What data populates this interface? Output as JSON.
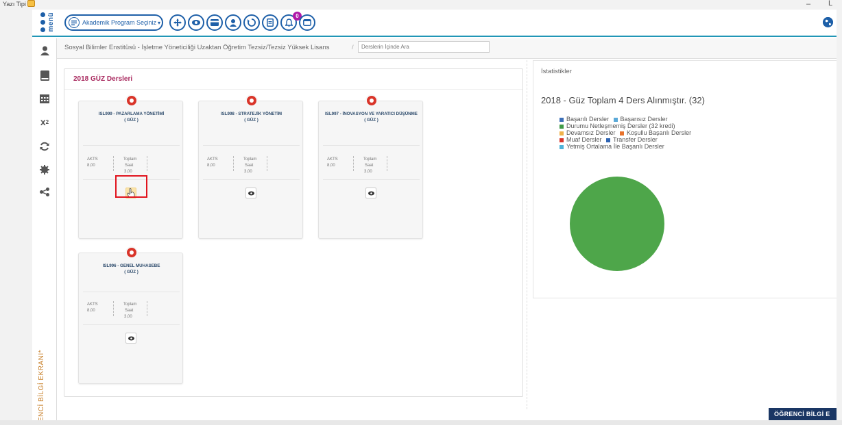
{
  "window": {
    "font_label": "Yazı Tipi",
    "min_glyph": "–",
    "max_glyph": "L"
  },
  "header": {
    "menu_label": "menü",
    "program_select_label": "Akademik Program Seçiniz",
    "notification_count": "0",
    "accent_color": "#1d5fa8"
  },
  "breadcrumb": {
    "path": "Sosyal Bilimler Enstitüsü - İşletme Yöneticiliği Uzaktan Öğretim Tezsiz/Tezsiz Yüksek Lisans",
    "separator": "/",
    "search_placeholder": "Derslerin İçinde Ara"
  },
  "sidebar": {
    "vertical_label": "ÖĞRENCİ BİLGİ EKRANI*",
    "icons": [
      "user-icon",
      "book-icon",
      "calendar-icon",
      "superscript-icon",
      "refresh-icon",
      "gear-icon",
      "share-icon"
    ]
  },
  "courses_panel": {
    "title": "2018 GÜZ Dersleri",
    "courses": [
      {
        "code_title": "ISL999 - PAZARLAMA YÖNETİMİ",
        "term": "( GÜZ )",
        "akts_label": "AKTS",
        "akts_value": "8,00",
        "total_label": "Toplam",
        "total_sub": "Saat",
        "total_value": "3,00"
      },
      {
        "code_title": "ISL998 - STRATEJİK YÖNETİM",
        "term": "( GÜZ )",
        "akts_label": "AKTS",
        "akts_value": "8,00",
        "total_label": "Toplam",
        "total_sub": "Saat",
        "total_value": "3,00"
      },
      {
        "code_title": "ISL997 - İNOVASYON VE YARATICI DÜŞÜNME",
        "term": "( GÜZ )",
        "akts_label": "AKTS",
        "akts_value": "8,00",
        "total_label": "Toplam",
        "total_sub": "Saat",
        "total_value": "3,00"
      },
      {
        "code_title": "ISL996 - GENEL MUHASEBE",
        "term": "( GÜZ )",
        "akts_label": "AKTS",
        "akts_value": "8,00",
        "total_label": "Toplam",
        "total_sub": "Saat",
        "total_value": "3,00"
      }
    ]
  },
  "stats": {
    "header": "İstatistikler",
    "title": "2018 - Güz Toplam 4 Ders Alınmıştır. (32)",
    "legend_rows": [
      [
        {
          "label": "Başarılı Dersler",
          "color": "#3c6fb8"
        },
        {
          "label": "Başarısız Dersler",
          "color": "#5aa9d8"
        }
      ],
      [
        {
          "label": "Durumu Netleşmemiş Dersler (32 kredi)",
          "color": "#3f9a47"
        }
      ],
      [
        {
          "label": "Devamsız Dersler",
          "color": "#f0b24a"
        },
        {
          "label": "Koşullu Başarılı Dersler",
          "color": "#e8722b"
        }
      ],
      [
        {
          "label": "Muaf Dersler",
          "color": "#d9352a"
        },
        {
          "label": "Transfer Dersler",
          "color": "#2f64b3"
        }
      ],
      [
        {
          "label": "Yetmiş Ortalama İle Başarılı Dersler",
          "color": "#4fb3d9"
        }
      ]
    ],
    "pie_color": "#4ea64a"
  },
  "chart_data": {
    "type": "pie",
    "title": "2018 - Güz Toplam 4 Ders Alınmıştır. (32)",
    "categories": [
      "Başarılı Dersler",
      "Başarısız Dersler",
      "Durumu Netleşmemiş Dersler (32 kredi)",
      "Devamsız Dersler",
      "Koşullu Başarılı Dersler",
      "Muaf Dersler",
      "Transfer Dersler",
      "Yetmiş Ortalama İle Başarılı Dersler"
    ],
    "values": [
      0,
      0,
      32,
      0,
      0,
      0,
      0,
      0
    ],
    "legend": "top-left"
  },
  "bottom_banner": {
    "label": "ÖĞRENCİ BİLGİ E"
  }
}
